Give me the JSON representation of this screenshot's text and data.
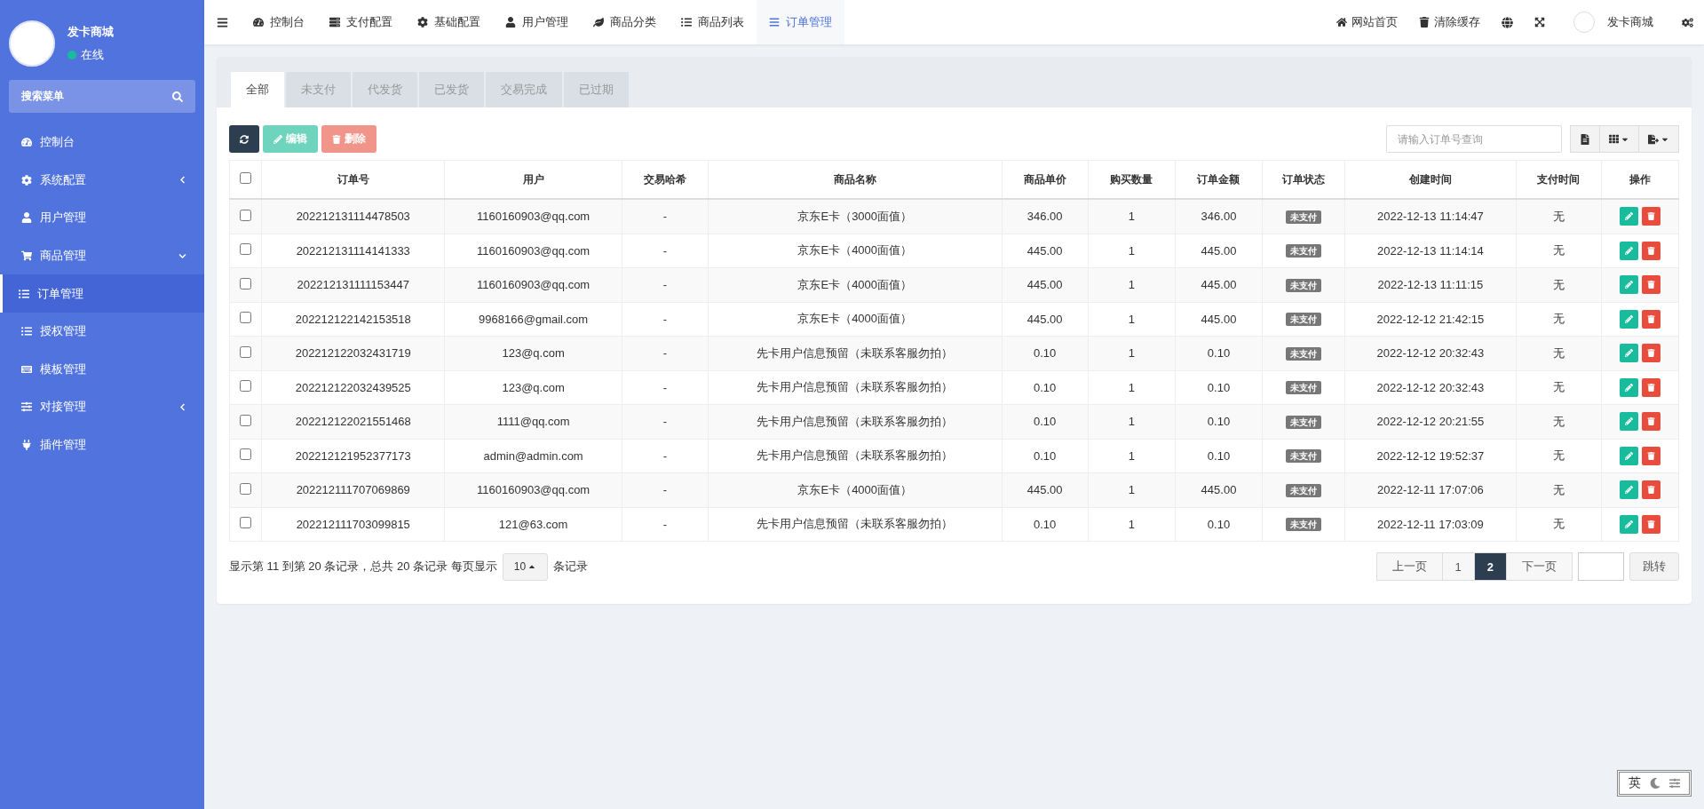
{
  "sidebar": {
    "brand": {
      "name": "发卡商城",
      "status": "在线",
      "online": true
    },
    "search": {
      "placeholder": "搜索菜单"
    },
    "items": [
      {
        "label": "控制台",
        "kind": "link",
        "selected": false
      },
      {
        "label": "系统配置",
        "kind": "group",
        "expanded": false,
        "selected": false
      },
      {
        "label": "用户管理",
        "kind": "link",
        "selected": false
      },
      {
        "label": "商品管理",
        "kind": "group",
        "expanded": true,
        "selected": false
      },
      {
        "label": "订单管理",
        "kind": "link",
        "selected": true
      },
      {
        "label": "授权管理",
        "kind": "link",
        "selected": false
      },
      {
        "label": "模板管理",
        "kind": "link",
        "selected": false
      },
      {
        "label": "对接管理",
        "kind": "group",
        "expanded": false,
        "selected": false
      },
      {
        "label": "插件管理",
        "kind": "link",
        "selected": false
      }
    ]
  },
  "topbar": {
    "nav": [
      {
        "label": "控制台",
        "selected": false
      },
      {
        "label": "支付配置",
        "selected": false
      },
      {
        "label": "基础配置",
        "selected": false
      },
      {
        "label": "用户管理",
        "selected": false
      },
      {
        "label": "商品分类",
        "selected": false
      },
      {
        "label": "商品列表",
        "selected": false
      },
      {
        "label": "订单管理",
        "selected": true
      }
    ],
    "links": [
      "网站首页",
      "清除缓存"
    ],
    "user": "发卡商城"
  },
  "tabs": [
    {
      "label": "全部",
      "selected": true
    },
    {
      "label": "未支付",
      "selected": false
    },
    {
      "label": "代发货",
      "selected": false
    },
    {
      "label": "已发货",
      "selected": false
    },
    {
      "label": "交易完成",
      "selected": false
    },
    {
      "label": "已过期",
      "selected": false
    }
  ],
  "toolbar": {
    "buttons": [
      {
        "kind": "refresh"
      },
      {
        "kind": "edit",
        "label": "编辑"
      },
      {
        "kind": "delete",
        "label": "删除"
      }
    ],
    "search": {
      "placeholder": "请输入订单号查询"
    }
  },
  "table": {
    "select_all": false,
    "columns": [
      "订单号",
      "用户",
      "交易哈希",
      "商品名称",
      "商品单价",
      "购买数量",
      "订单金额",
      "订单状态",
      "创建时间",
      "支付时间",
      "操作"
    ],
    "rows": [
      {
        "checked": false,
        "order": "202212131114478503",
        "user": "1160160903@qq.com",
        "hash": "-",
        "product": "京东E卡（3000面值）",
        "price": "346.00",
        "qty": "1",
        "amount": "346.00",
        "status": "未支付",
        "created": "2022-12-13 11:14:47",
        "paid": "无"
      },
      {
        "checked": false,
        "order": "202212131114141333",
        "user": "1160160903@qq.com",
        "hash": "-",
        "product": "京东E卡（4000面值）",
        "price": "445.00",
        "qty": "1",
        "amount": "445.00",
        "status": "未支付",
        "created": "2022-12-13 11:14:14",
        "paid": "无"
      },
      {
        "checked": false,
        "order": "202212131111153447",
        "user": "1160160903@qq.com",
        "hash": "-",
        "product": "京东E卡（4000面值）",
        "price": "445.00",
        "qty": "1",
        "amount": "445.00",
        "status": "未支付",
        "created": "2022-12-13 11:11:15",
        "paid": "无"
      },
      {
        "checked": false,
        "order": "202212122142153518",
        "user": "9968166@gmail.com",
        "hash": "-",
        "product": "京东E卡（4000面值）",
        "price": "445.00",
        "qty": "1",
        "amount": "445.00",
        "status": "未支付",
        "created": "2022-12-12 21:42:15",
        "paid": "无"
      },
      {
        "checked": false,
        "order": "202212122032431719",
        "user": "123@q.com",
        "hash": "-",
        "product": "先卡用户信息预留（未联系客服勿拍）",
        "price": "0.10",
        "qty": "1",
        "amount": "0.10",
        "status": "未支付",
        "created": "2022-12-12 20:32:43",
        "paid": "无"
      },
      {
        "checked": false,
        "order": "202212122032439525",
        "user": "123@q.com",
        "hash": "-",
        "product": "先卡用户信息预留（未联系客服勿拍）",
        "price": "0.10",
        "qty": "1",
        "amount": "0.10",
        "status": "未支付",
        "created": "2022-12-12 20:32:43",
        "paid": "无"
      },
      {
        "checked": false,
        "order": "202212122021551468",
        "user": "1111@qq.com",
        "hash": "-",
        "product": "先卡用户信息预留（未联系客服勿拍）",
        "price": "0.10",
        "qty": "1",
        "amount": "0.10",
        "status": "未支付",
        "created": "2022-12-12 20:21:55",
        "paid": "无"
      },
      {
        "checked": false,
        "order": "202212121952377173",
        "user": "admin@admin.com",
        "hash": "-",
        "product": "先卡用户信息预留（未联系客服勿拍）",
        "price": "0.10",
        "qty": "1",
        "amount": "0.10",
        "status": "未支付",
        "created": "2022-12-12 19:52:37",
        "paid": "无"
      },
      {
        "checked": false,
        "order": "202212111707069869",
        "user": "1160160903@qq.com",
        "hash": "-",
        "product": "京东E卡（4000面值）",
        "price": "445.00",
        "qty": "1",
        "amount": "445.00",
        "status": "未支付",
        "created": "2022-12-11 17:07:06",
        "paid": "无"
      },
      {
        "checked": false,
        "order": "202212111703099815",
        "user": "121@63.com",
        "hash": "-",
        "product": "先卡用户信息预留（未联系客服勿拍）",
        "price": "0.10",
        "qty": "1",
        "amount": "0.10",
        "status": "未支付",
        "created": "2022-12-11 17:03:09",
        "paid": "无"
      }
    ]
  },
  "footer": {
    "summary": "显示第 11 到第 20 条记录，总共 20 条记录 每页显示",
    "page_size": "10",
    "suffix": "条记录",
    "pager": [
      {
        "label": "上一页",
        "selected": false
      },
      {
        "label": "1",
        "selected": false
      },
      {
        "label": "2",
        "selected": true
      },
      {
        "label": "下一页",
        "selected": false
      }
    ],
    "jump": "跳转"
  },
  "ime": {
    "label": "英"
  }
}
